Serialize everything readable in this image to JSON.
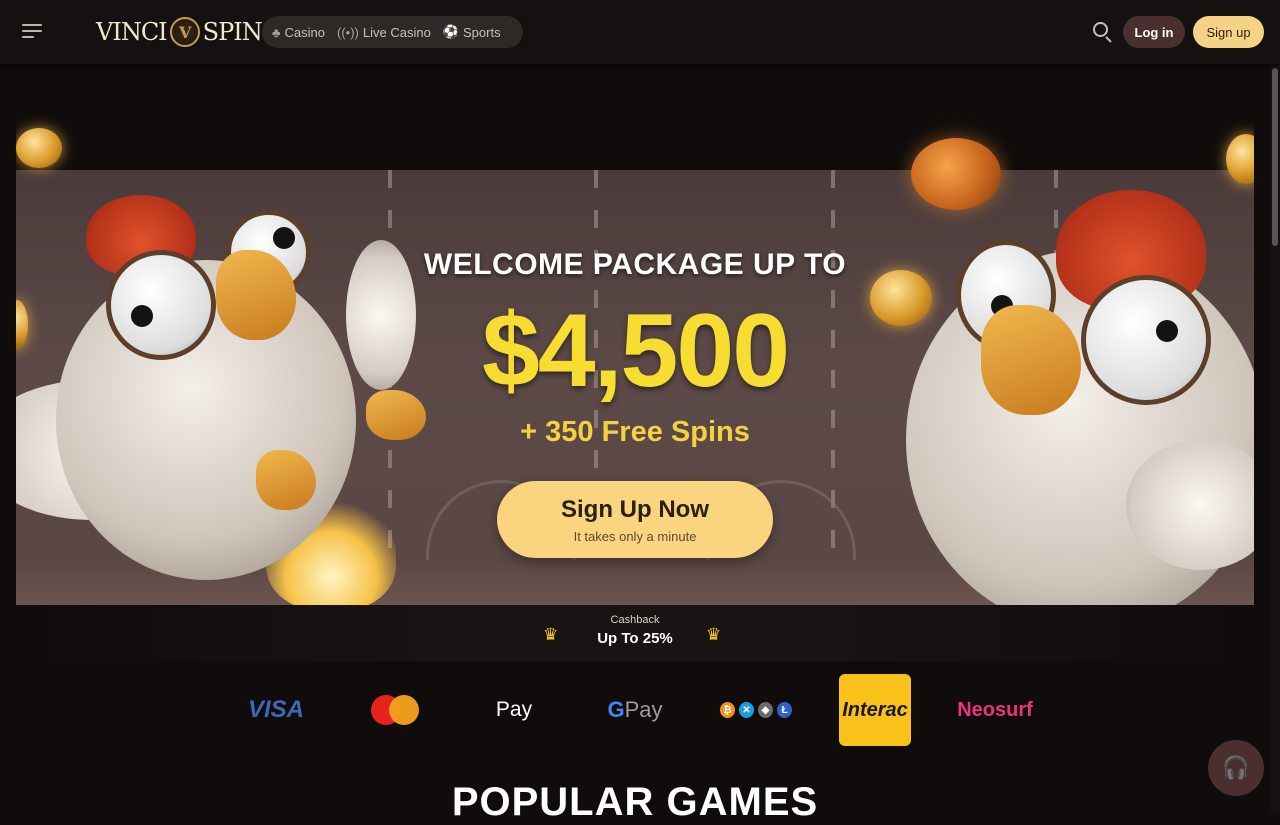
{
  "header": {
    "menu_icon": "hamburger-icon",
    "logo_left": "VINCI",
    "logo_emblem": "V",
    "logo_right": "SPIN",
    "nav": [
      {
        "label": "Casino",
        "icon": "cherry-icon"
      },
      {
        "label": "Live Casino",
        "icon": "broadcast-icon"
      },
      {
        "label": "Sports",
        "icon": "soccer-ball-icon"
      }
    ],
    "search_icon": "search-icon",
    "login_label": "Log in",
    "signup_label": "Sign up"
  },
  "hero": {
    "title": "WELCOME PACKAGE UP TO",
    "amount": "$4,500",
    "spins": "+ 350 Free Spins",
    "cta_label": "Sign Up Now",
    "cta_sub": "It takes only a minute"
  },
  "cashback": {
    "label": "Cashback",
    "value": "Up To 25%"
  },
  "payments": {
    "visa": "VISA",
    "mastercard": "mastercard-logo",
    "apple_pay": "Pay",
    "google_pay_g": "G",
    "google_pay": "Pay",
    "crypto": "crypto-logos",
    "interac": "Interac",
    "neosurf": "Neosurf"
  },
  "support_icon": "headset-icon",
  "section_title": "POPULAR GAMES",
  "colors": {
    "accent_yellow": "#f7dd32",
    "cta_bg": "#fad47e",
    "login_bg": "#4b2f2f",
    "page_bg": "#0f0c0b"
  }
}
